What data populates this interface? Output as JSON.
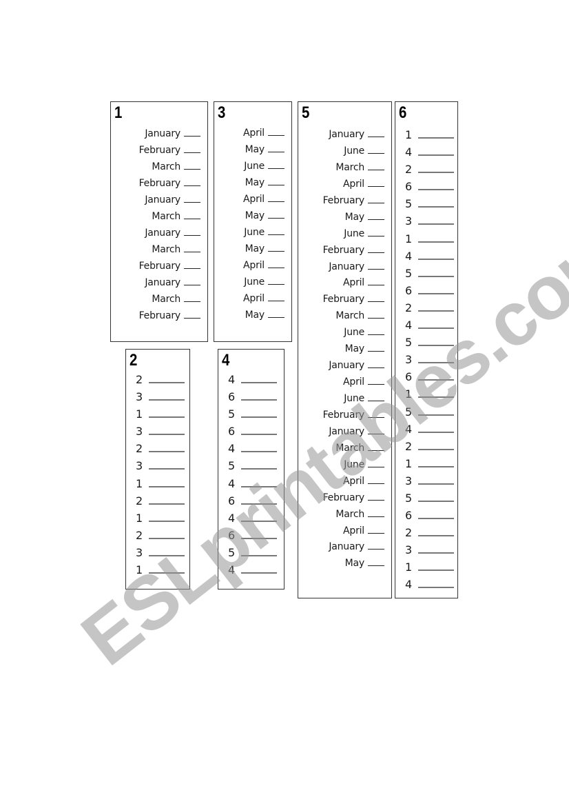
{
  "watermark": "ESLprintables.com",
  "boxes": {
    "b1": {
      "number": "1",
      "items": [
        "January",
        "February",
        "March",
        "February",
        "January",
        "March",
        "January",
        "March",
        "February",
        "January",
        "March",
        "February"
      ]
    },
    "b2": {
      "number": "2",
      "items": [
        "2",
        "3",
        "1",
        "3",
        "2",
        "3",
        "1",
        "2",
        "1",
        "2",
        "3",
        "1"
      ]
    },
    "b3": {
      "number": "3",
      "items": [
        "April",
        "May",
        "June",
        "May",
        "April",
        "May",
        "June",
        "May",
        "April",
        "June",
        "April",
        "May"
      ]
    },
    "b4": {
      "number": "4",
      "items": [
        "4",
        "6",
        "5",
        "6",
        "4",
        "5",
        "4",
        "6",
        "4",
        "6",
        "5",
        "4"
      ]
    },
    "b5": {
      "number": "5",
      "items": [
        "January",
        "June",
        "March",
        "April",
        "February",
        "May",
        "June",
        "February",
        "January",
        "April",
        "February",
        "March",
        "June",
        "May",
        "January",
        "April",
        "June",
        "February",
        "January",
        "March",
        "June",
        "April",
        "February",
        "March",
        "April",
        "January",
        "May"
      ]
    },
    "b6": {
      "number": "6",
      "items": [
        "1",
        "4",
        "2",
        "6",
        "5",
        "3",
        "1",
        "4",
        "5",
        "6",
        "2",
        "4",
        "5",
        "3",
        "6",
        "1",
        "5",
        "4",
        "2",
        "1",
        "3",
        "5",
        "6",
        "2",
        "3",
        "1",
        "4"
      ]
    }
  }
}
